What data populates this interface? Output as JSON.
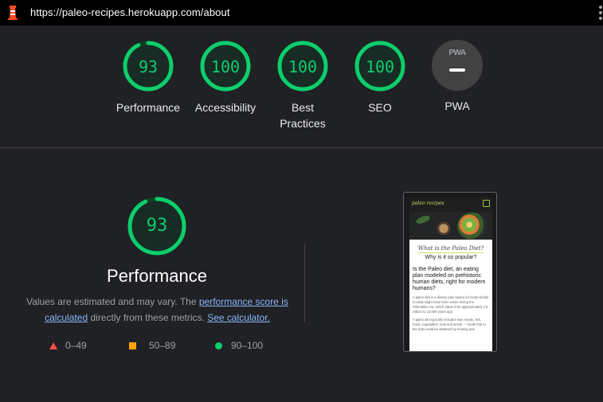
{
  "browser": {
    "url": "https://paleo-recipes.herokuapp.com/about",
    "logo_icon": "lighthouse-icon",
    "menu_icon": "kebab-menu-icon"
  },
  "scores": [
    {
      "label": "Performance",
      "value": "93",
      "score": 93
    },
    {
      "label": "Accessibility",
      "value": "100",
      "score": 100
    },
    {
      "label": "Best Practices",
      "value": "100",
      "score": 100
    },
    {
      "label": "SEO",
      "value": "100",
      "score": 100
    },
    {
      "label": "PWA",
      "badge": "PWA"
    }
  ],
  "performance": {
    "value": "93",
    "score": 93,
    "title": "Performance",
    "desc_prefix": "Values are estimated and may vary. The ",
    "desc_link1": "performance score is calculated",
    "desc_middle": " directly from these metrics. ",
    "desc_link2": "See calculator."
  },
  "legend": [
    {
      "range": "0–49",
      "color": "#ff4e42"
    },
    {
      "range": "50–89",
      "color": "#ffa400"
    },
    {
      "range": "90–100",
      "color": "#0cce6b"
    }
  ],
  "screenshot": {
    "brand": "paleo recipes",
    "heading": "What is the Paleo Diet?",
    "subheading": "Why is it so popular?",
    "question": "Is the Paleo diet, an eating plan modeled on prehistoric human diets, right for modern humans?",
    "para1": "A paleo diet is a dietary plan based on foods similar to what might have been eaten during the Paleolithic era, which dates from approximately 2.5 million to 10,000 years ago.",
    "para2": "A paleo diet typically includes lean meats, fish, fruits, vegetables, nuts and seeds — foods that in the past could be obtained by hunting and"
  },
  "colors": {
    "pass": "#0cce6b",
    "background": "#202124",
    "ring_track": "#0c3f24"
  }
}
